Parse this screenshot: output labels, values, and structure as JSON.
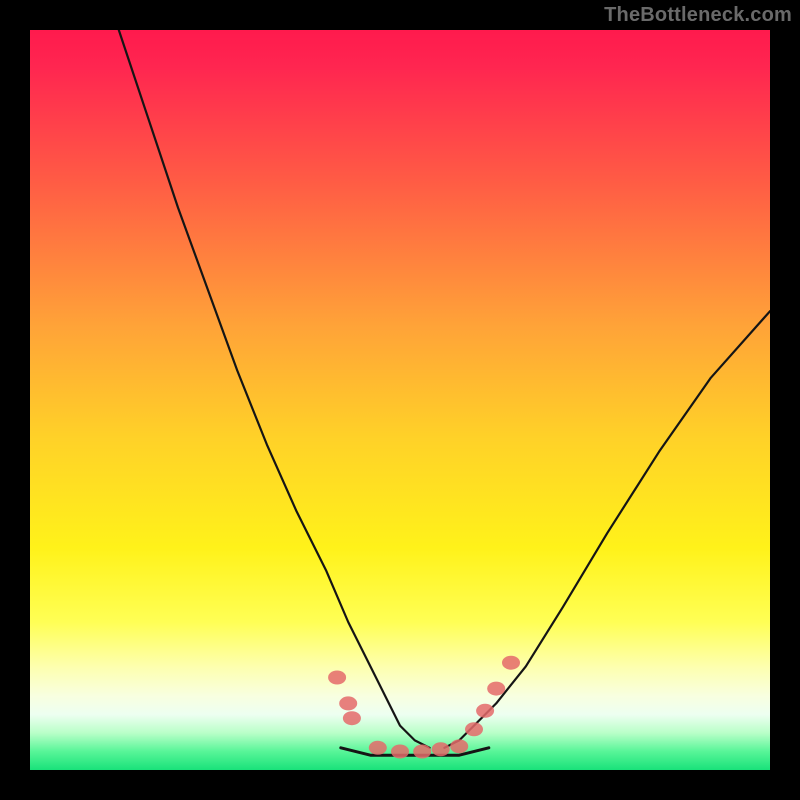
{
  "attribution": "TheBottleneck.com",
  "colors": {
    "bg": "#000000",
    "curve": "#151515",
    "marker": "#e46a6a",
    "gradient_stops": [
      {
        "offset": 0.0,
        "color": "#ff1a4d"
      },
      {
        "offset": 0.05,
        "color": "#ff2650"
      },
      {
        "offset": 0.2,
        "color": "#ff5a45"
      },
      {
        "offset": 0.4,
        "color": "#ffa338"
      },
      {
        "offset": 0.55,
        "color": "#ffd128"
      },
      {
        "offset": 0.7,
        "color": "#fff21a"
      },
      {
        "offset": 0.8,
        "color": "#ffff55"
      },
      {
        "offset": 0.86,
        "color": "#fdffae"
      },
      {
        "offset": 0.9,
        "color": "#f8ffe0"
      },
      {
        "offset": 0.925,
        "color": "#edfff1"
      },
      {
        "offset": 0.95,
        "color": "#b9ffc8"
      },
      {
        "offset": 0.975,
        "color": "#58f598"
      },
      {
        "offset": 1.0,
        "color": "#19e27a"
      }
    ]
  },
  "chart_data": {
    "type": "line",
    "title": "",
    "xlabel": "",
    "ylabel": "",
    "ylim": [
      0,
      100
    ],
    "xlim": [
      0,
      100
    ],
    "series": [
      {
        "name": "left-curve",
        "x": [
          12,
          16,
          20,
          24,
          28,
          32,
          36,
          40,
          43,
          46,
          48,
          50,
          52,
          54
        ],
        "values": [
          100,
          88,
          76,
          65,
          54,
          44,
          35,
          27,
          20,
          14,
          10,
          6,
          4,
          3
        ]
      },
      {
        "name": "right-curve",
        "x": [
          56,
          58,
          60,
          63,
          67,
          72,
          78,
          85,
          92,
          100
        ],
        "values": [
          3,
          4,
          6,
          9,
          14,
          22,
          32,
          43,
          53,
          62
        ]
      },
      {
        "name": "floor",
        "x": [
          42,
          46,
          50,
          54,
          58,
          62
        ],
        "values": [
          3,
          2,
          2,
          2,
          2,
          3
        ]
      }
    ],
    "markers": {
      "name": "highlighted-points",
      "x": [
        41.5,
        43.0,
        43.5,
        47.0,
        50.0,
        53.0,
        55.5,
        58.0,
        60.0,
        61.5,
        63.0,
        65.0
      ],
      "values": [
        12.5,
        9.0,
        7.0,
        3.0,
        2.5,
        2.5,
        2.8,
        3.2,
        5.5,
        8.0,
        11.0,
        14.5
      ]
    }
  }
}
